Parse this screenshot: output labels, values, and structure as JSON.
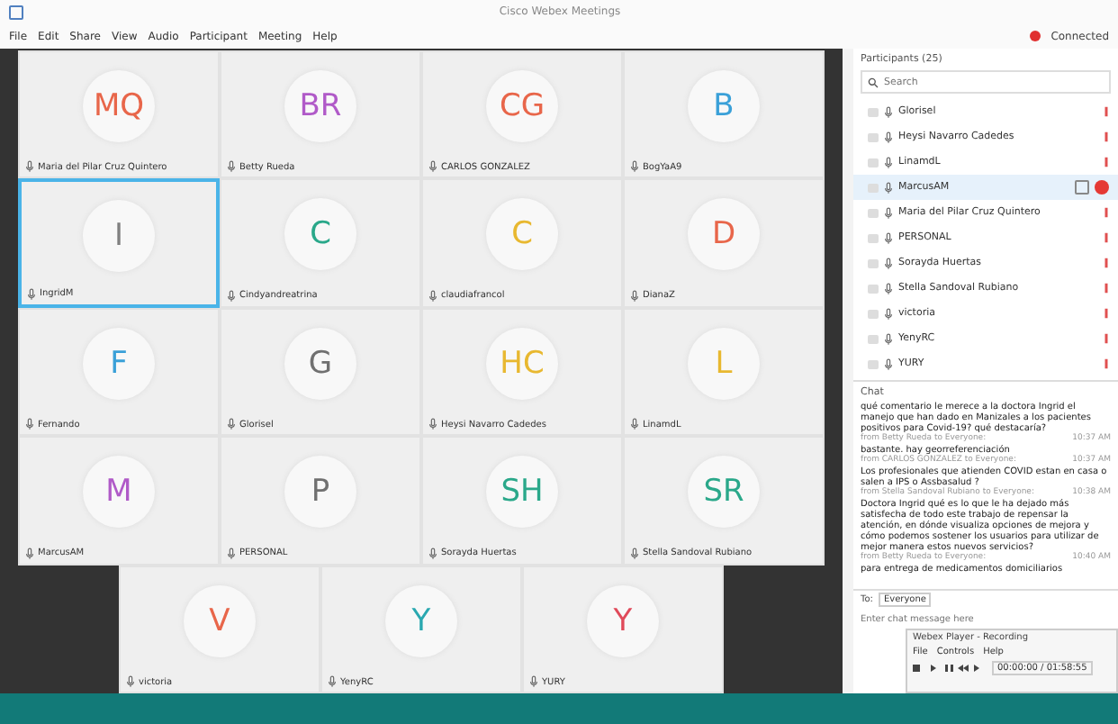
{
  "window": {
    "title": "Cisco Webex Meetings",
    "status": "Connected"
  },
  "menu": [
    "File",
    "Edit",
    "Share",
    "View",
    "Audio",
    "Participant",
    "Meeting",
    "Help"
  ],
  "gallery": [
    [
      {
        "initials": "MQ",
        "color": "#e8664a",
        "name": "Maria del Pilar Cruz Quintero",
        "selected": false
      },
      {
        "initials": "BR",
        "color": "#b05ac8",
        "name": "Betty Rueda",
        "selected": false
      },
      {
        "initials": "CG",
        "color": "#e8664a",
        "name": "CARLOS GONZALEZ",
        "selected": false
      },
      {
        "initials": "B",
        "color": "#3aa0d8",
        "name": "BogYaA9",
        "selected": false
      }
    ],
    [
      {
        "initials": "I",
        "color": "#808080",
        "name": "IngridM",
        "selected": true
      },
      {
        "initials": "C",
        "color": "#2aa88a",
        "name": "Cindyandreatrina",
        "selected": false
      },
      {
        "initials": "C",
        "color": "#e8b830",
        "name": "claudiafrancol",
        "selected": false
      },
      {
        "initials": "D",
        "color": "#e8664a",
        "name": "DianaZ",
        "selected": false
      }
    ],
    [
      {
        "initials": "F",
        "color": "#3aa0d8",
        "name": "Fernando",
        "selected": false
      },
      {
        "initials": "G",
        "color": "#707070",
        "name": "Glorisel",
        "selected": false
      },
      {
        "initials": "HC",
        "color": "#e8b830",
        "name": "Heysi Navarro Cadedes",
        "selected": false
      },
      {
        "initials": "L",
        "color": "#e8b830",
        "name": "LinamdL",
        "selected": false
      }
    ],
    [
      {
        "initials": "M",
        "color": "#b05ac8",
        "name": "MarcusAM",
        "selected": false
      },
      {
        "initials": "P",
        "color": "#707070",
        "name": "PERSONAL",
        "selected": false
      },
      {
        "initials": "SH",
        "color": "#2aa88a",
        "name": "Sorayda Huertas",
        "selected": false
      },
      {
        "initials": "SR",
        "color": "#2aa88a",
        "name": "Stella Sandoval Rubiano",
        "selected": false
      }
    ],
    [
      {
        "initials": "V",
        "color": "#e8664a",
        "name": "victoria",
        "selected": false
      },
      {
        "initials": "Y",
        "color": "#2aa8b0",
        "name": "YenyRC",
        "selected": false
      },
      {
        "initials": "Y",
        "color": "#e04a5a",
        "name": "YURY",
        "selected": false
      }
    ]
  ],
  "participants": {
    "title": "Participants (25)",
    "search": {
      "placeholder": "Search"
    },
    "items": [
      {
        "name": "Glorisel",
        "selected": false
      },
      {
        "name": "Heysi Navarro Cadedes",
        "selected": false
      },
      {
        "name": "LinamdL",
        "selected": false
      },
      {
        "name": "MarcusAM",
        "selected": true
      },
      {
        "name": "Maria del Pilar Cruz Quintero",
        "selected": false
      },
      {
        "name": "PERSONAL",
        "selected": false
      },
      {
        "name": "Sorayda Huertas",
        "selected": false
      },
      {
        "name": "Stella Sandoval Rubiano",
        "selected": false
      },
      {
        "name": "victoria",
        "selected": false
      },
      {
        "name": "YenyRC",
        "selected": false
      },
      {
        "name": "YURY",
        "selected": false
      }
    ]
  },
  "chat": {
    "title": "Chat",
    "messages": [
      {
        "text": "qué comentario le merece a la doctora Ingrid el manejo que han dado en Manizales a los pacientes positivos para Covid-19? qué destacaría?",
        "from": "from Betty Rueda to Everyone:",
        "time": "10:37 AM"
      },
      {
        "text": "bastante. hay georreferenciación",
        "from": "from CARLOS GONZALEZ to Everyone:",
        "time": "10:37 AM"
      },
      {
        "text": "Los profesionales que atienden COVID estan en casa o salen a IPS o Assbasalud ?",
        "from": "from Stella Sandoval Rubiano to Everyone:",
        "time": "10:38 AM"
      },
      {
        "text": "Doctora Ingrid qué es lo que le ha dejado más satisfecha de todo este trabajo de repensar la atención, en dónde visualiza opciones de mejora y cómo podemos sostener los usuarios para utilizar de mejor manera estos nuevos servicios?",
        "from": "from Betty Rueda to Everyone:",
        "time": "10:40 AM"
      },
      {
        "text": "para entrega de medicamentos domiciliarios"
      }
    ],
    "to_label": "To:",
    "to_value": "Everyone",
    "input": {
      "placeholder": "Enter chat message here"
    }
  },
  "player": {
    "title": "Webex Player - Recording",
    "menu": [
      "File",
      "Controls",
      "Help"
    ],
    "time": "00:00:00 / 01:58:55"
  }
}
